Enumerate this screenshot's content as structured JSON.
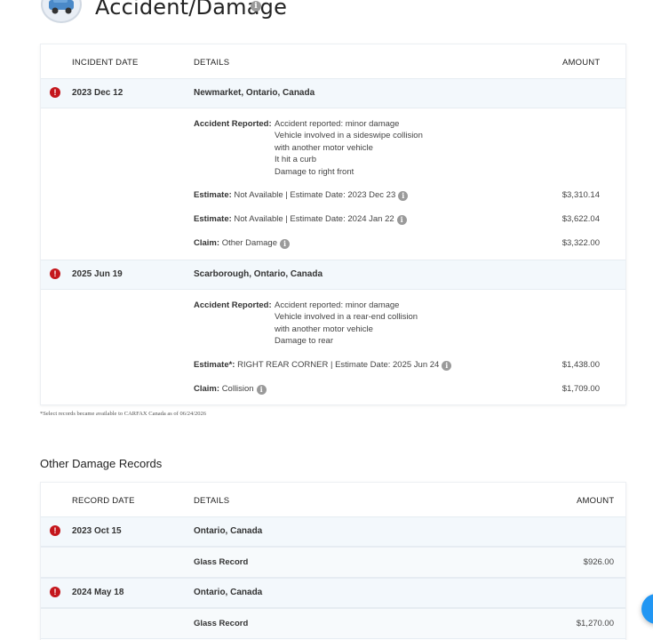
{
  "accident": {
    "title": "Accident/Damage",
    "headers": {
      "date": "INCIDENT DATE",
      "details": "DETAILS",
      "amount": "AMOUNT"
    },
    "records": [
      {
        "date": "2023 Dec 12",
        "location": "Newmarket, Ontario, Canada",
        "reported_label": "Accident Reported:",
        "reported_lines": [
          "Accident reported: minor damage",
          "Vehicle involved in a sideswipe collision",
          "with another motor vehicle",
          "It hit a curb",
          "Damage to right front"
        ],
        "items": [
          {
            "label": "Estimate:",
            "text": "Not Available | Estimate Date: 2023 Dec 23",
            "amount": "$3,310.14"
          },
          {
            "label": "Estimate:",
            "text": "Not Available | Estimate Date: 2024 Jan 22",
            "amount": "$3,622.04"
          },
          {
            "label": "Claim:",
            "text": "Other Damage",
            "amount": "$3,322.00"
          }
        ]
      },
      {
        "date": "2025 Jun 19",
        "location": "Scarborough, Ontario, Canada",
        "reported_label": "Accident Reported:",
        "reported_lines": [
          "Accident reported: minor damage",
          "Vehicle involved in a rear-end collision",
          "with another motor vehicle",
          "Damage to rear"
        ],
        "items": [
          {
            "label": "Estimate*:",
            "text": "RIGHT REAR CORNER | Estimate Date: 2025 Jun 24",
            "amount": "$1,438.00"
          },
          {
            "label": "Claim:",
            "text": "Collision",
            "amount": "$1,709.00"
          }
        ]
      }
    ],
    "footnote": "*Select records became available to CARFAX Canada as of 06/24/2026"
  },
  "other": {
    "title": "Other Damage Records",
    "headers": {
      "date": "RECORD DATE",
      "details": "DETAILS",
      "amount": "AMOUNT"
    },
    "records": [
      {
        "date": "2023 Oct 15",
        "location": "Ontario, Canada",
        "detail": "Glass Record",
        "amount": "$926.00"
      },
      {
        "date": "2024 May 18",
        "location": "Ontario, Canada",
        "detail": "Glass Record",
        "amount": "$1,270.00"
      }
    ]
  },
  "icons": {
    "alert": "alert-circle-icon",
    "info": "info-icon",
    "logo": "car-damage-logo"
  },
  "colors": {
    "alert": "#c4161c",
    "band": "#f3f8fc",
    "fab": "#2196f3"
  }
}
